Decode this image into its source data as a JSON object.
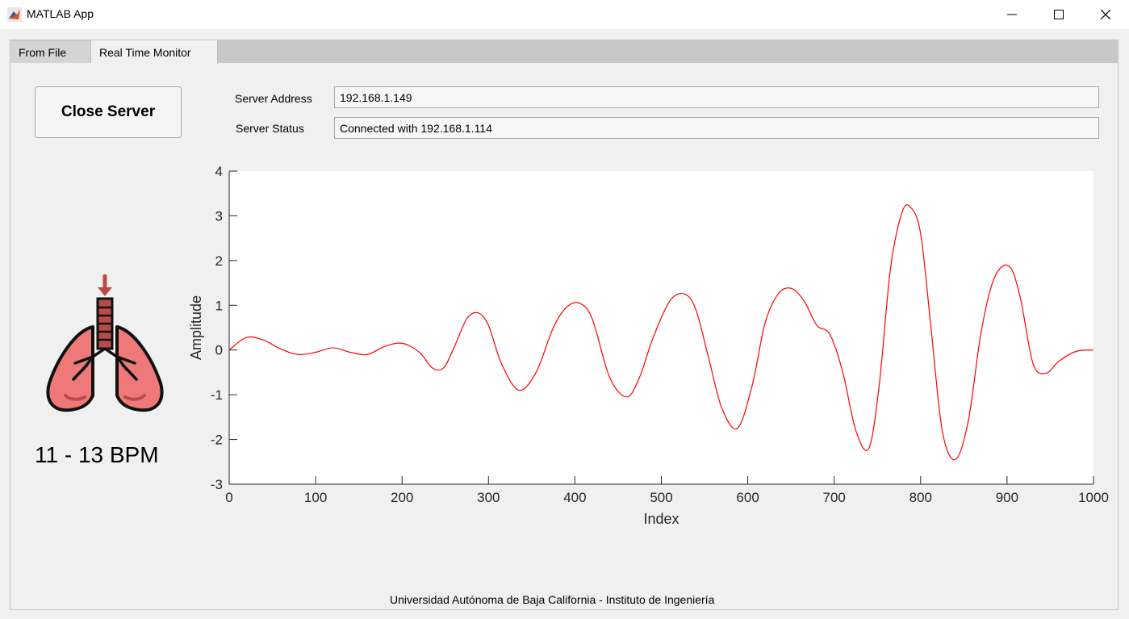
{
  "window": {
    "title": "MATLAB App",
    "icon": "matlab-icon"
  },
  "tabs": [
    {
      "label": "From File",
      "active": false
    },
    {
      "label": "Real Time Monitor",
      "active": true
    }
  ],
  "controls": {
    "close_server_label": "Close Server",
    "server_address_label": "Server Address",
    "server_address_value": "192.168.1.149",
    "server_status_label": "Server Status",
    "server_status_value": "Connected with 192.168.1.114"
  },
  "monitor": {
    "icon": "lungs-icon",
    "bpm_text": "11 - 13 BPM"
  },
  "footer": {
    "text": "Universidad Autónoma de Baja California - Instituto de Ingeniería"
  },
  "colors": {
    "line": "#ff0000",
    "panel_bg": "#f0f0f0",
    "tabstrip_bg": "#c8c8c8"
  },
  "chart_data": {
    "type": "line",
    "xlabel": "Index",
    "ylabel": "Amplitude",
    "xlim": [
      0,
      1000
    ],
    "ylim": [
      -3,
      4
    ],
    "xticks": [
      0,
      100,
      200,
      300,
      400,
      500,
      600,
      700,
      800,
      900,
      1000
    ],
    "yticks": [
      -3,
      -2,
      -1,
      0,
      1,
      2,
      3,
      4
    ],
    "grid": false,
    "series": [
      {
        "x": [
          0,
          20,
          40,
          60,
          80,
          100,
          120,
          140,
          160,
          180,
          200,
          220,
          235,
          248,
          260,
          275,
          288,
          300,
          315,
          335,
          355,
          375,
          390,
          405,
          420,
          440,
          460,
          475,
          490,
          510,
          527,
          540,
          555,
          570,
          588,
          605,
          620,
          635,
          650,
          665,
          680,
          695,
          710,
          725,
          740,
          752,
          765,
          778,
          788,
          800,
          812,
          825,
          840,
          855,
          870,
          885,
          902,
          915,
          930,
          945,
          960,
          980,
          1000
        ],
        "y": [
          0.0,
          0.28,
          0.22,
          0.02,
          -0.1,
          -0.05,
          0.05,
          -0.05,
          -0.1,
          0.08,
          0.15,
          -0.05,
          -0.4,
          -0.4,
          0.05,
          0.7,
          0.83,
          0.55,
          -0.3,
          -0.9,
          -0.5,
          0.5,
          0.95,
          1.05,
          0.7,
          -0.6,
          -1.05,
          -0.6,
          0.25,
          1.1,
          1.25,
          0.9,
          -0.2,
          -1.3,
          -1.75,
          -0.8,
          0.6,
          1.25,
          1.38,
          1.1,
          0.55,
          0.35,
          -0.5,
          -1.8,
          -2.2,
          -0.8,
          1.8,
          3.05,
          3.2,
          2.6,
          0.5,
          -1.8,
          -2.45,
          -1.6,
          0.4,
          1.6,
          1.88,
          1.2,
          -0.3,
          -0.52,
          -0.25,
          -0.03,
          0.0
        ]
      }
    ]
  }
}
